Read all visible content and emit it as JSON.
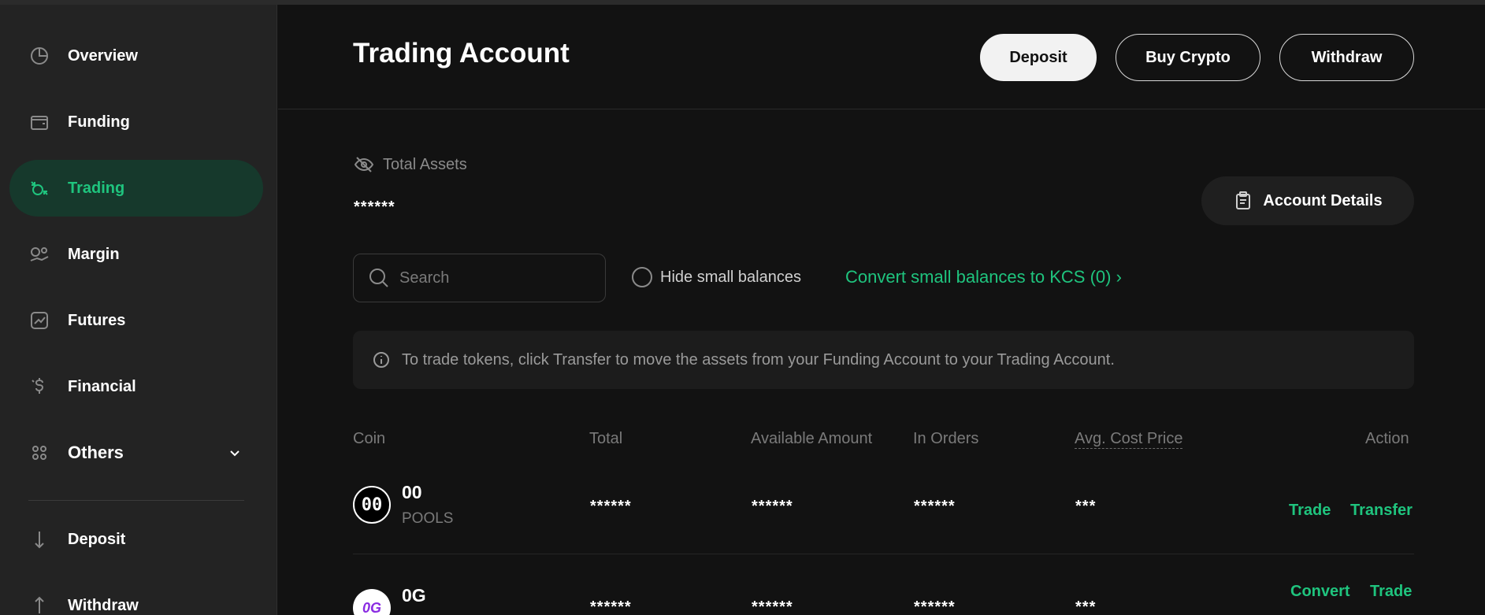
{
  "sidebar": {
    "items": [
      {
        "label": "Overview",
        "icon": "pie-chart-icon"
      },
      {
        "label": "Funding",
        "icon": "wallet-icon"
      },
      {
        "label": "Trading",
        "icon": "trading-icon"
      },
      {
        "label": "Margin",
        "icon": "margin-icon"
      },
      {
        "label": "Futures",
        "icon": "futures-chart-icon"
      },
      {
        "label": "Financial",
        "icon": "dollar-icon"
      },
      {
        "label": "Others",
        "icon": "grid-dots-icon"
      },
      {
        "label": "Deposit",
        "icon": "arrow-down-icon"
      },
      {
        "label": "Withdraw",
        "icon": "arrow-up-icon"
      }
    ]
  },
  "header": {
    "title": "Trading Account",
    "deposit": "Deposit",
    "buy_crypto": "Buy Crypto",
    "withdraw": "Withdraw"
  },
  "assets": {
    "label": "Total Assets",
    "value": "******",
    "account_details": "Account Details"
  },
  "filters": {
    "search_placeholder": "Search",
    "hide_small": "Hide small balances",
    "convert_link": "Convert small balances to KCS (0) ›"
  },
  "notice": "To trade tokens, click Transfer to move the assets from your Funding Account to your Trading Account.",
  "table": {
    "headers": {
      "coin": "Coin",
      "total": "Total",
      "available": "Available Amount",
      "in_orders": "In Orders",
      "avg_cost": "Avg. Cost Price",
      "action": "Action"
    },
    "rows": [
      {
        "logo": "00",
        "symbol": "00",
        "name": "POOLS",
        "total": "******",
        "available": "******",
        "in_orders": "******",
        "avg_cost": "***",
        "actions": [
          "Trade",
          "Transfer"
        ]
      },
      {
        "logo": "0G",
        "symbol": "0G",
        "name": "",
        "total": "******",
        "available": "******",
        "in_orders": "******",
        "avg_cost": "***",
        "actions": [
          "Convert",
          "Trade"
        ]
      }
    ]
  },
  "colors": {
    "accent": "#1fc47e",
    "background": "#121212",
    "sidebar": "#232323",
    "active_bg": "#16392c"
  }
}
